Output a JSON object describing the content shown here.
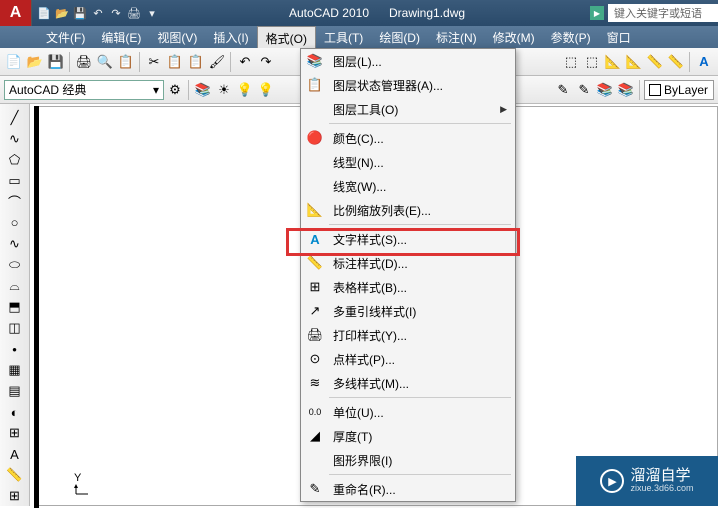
{
  "app": {
    "name": "AutoCAD 2010",
    "document": "Drawing1.dwg",
    "logo_letter": "A"
  },
  "search": {
    "placeholder": "键入关键字或短语"
  },
  "menu": {
    "items": [
      {
        "label": "文件(F)"
      },
      {
        "label": "编辑(E)"
      },
      {
        "label": "视图(V)"
      },
      {
        "label": "插入(I)"
      },
      {
        "label": "格式(O)",
        "active": true
      },
      {
        "label": "工具(T)"
      },
      {
        "label": "绘图(D)"
      },
      {
        "label": "标注(N)"
      },
      {
        "label": "修改(M)"
      },
      {
        "label": "参数(P)"
      },
      {
        "label": "窗口"
      }
    ]
  },
  "workspace": {
    "label": "AutoCAD 经典"
  },
  "bylayer": {
    "label": "ByLayer"
  },
  "dropdown": {
    "items": [
      {
        "label": "图层(L)...",
        "icon": "layers"
      },
      {
        "label": "图层状态管理器(A)...",
        "icon": "layer-state"
      },
      {
        "label": "图层工具(O)",
        "icon": "",
        "submenu": true
      },
      {
        "sep": true
      },
      {
        "label": "颜色(C)...",
        "icon": "color"
      },
      {
        "label": "线型(N)...",
        "icon": ""
      },
      {
        "label": "线宽(W)...",
        "icon": ""
      },
      {
        "label": "比例缩放列表(E)...",
        "icon": "scale"
      },
      {
        "sep": true
      },
      {
        "label": "文字样式(S)...",
        "icon": "text-style"
      },
      {
        "label": "标注样式(D)...",
        "icon": "dim-style",
        "highlight": true
      },
      {
        "label": "表格样式(B)...",
        "icon": "table-style"
      },
      {
        "label": "多重引线样式(I)",
        "icon": "leader"
      },
      {
        "label": "打印样式(Y)...",
        "icon": "print"
      },
      {
        "label": "点样式(P)...",
        "icon": "point"
      },
      {
        "label": "多线样式(M)...",
        "icon": "mline"
      },
      {
        "sep": true
      },
      {
        "label": "单位(U)...",
        "icon": "units"
      },
      {
        "label": "厚度(T)",
        "icon": "thickness"
      },
      {
        "label": "图形界限(I)",
        "icon": ""
      },
      {
        "sep": true
      },
      {
        "label": "重命名(R)...",
        "icon": "rename"
      }
    ]
  },
  "ucs": {
    "y_label": "Y"
  },
  "watermark": {
    "text": "溜溜自学",
    "sub": "zixue.3d66.com"
  }
}
